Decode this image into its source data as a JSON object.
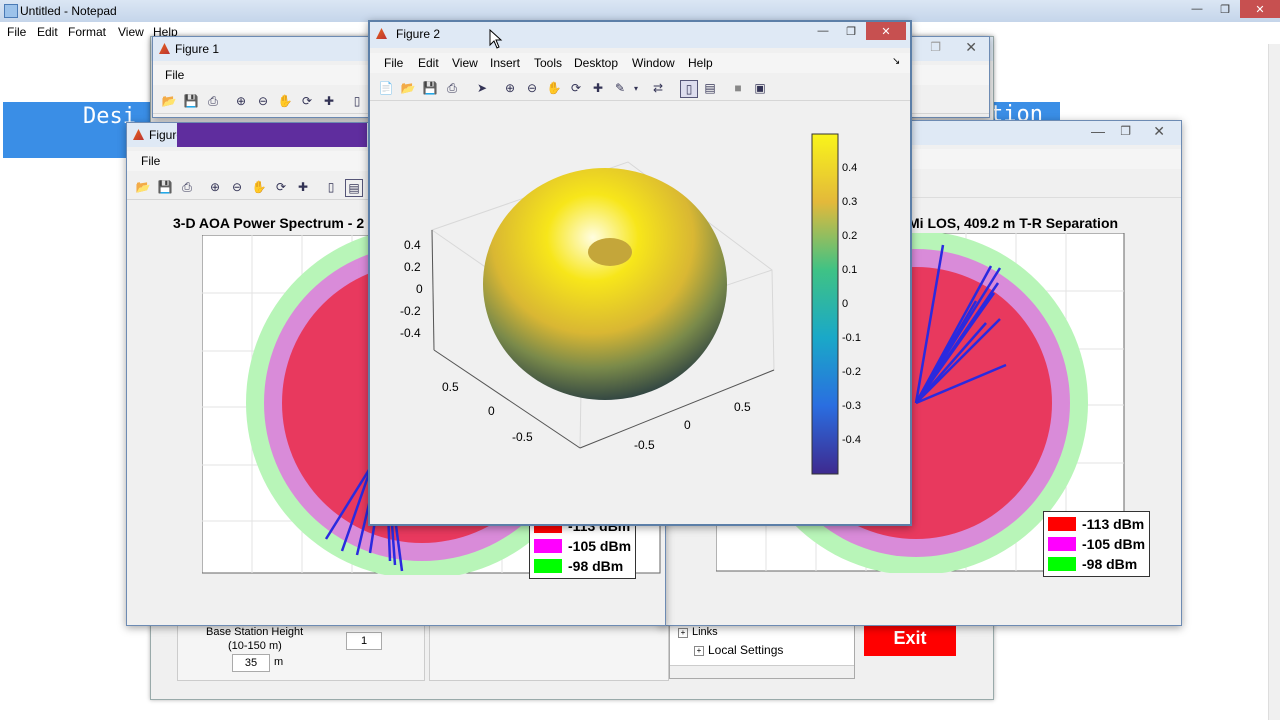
{
  "notepad": {
    "title": "Untitled - Notepad",
    "menu": [
      "File",
      "Edit",
      "Format",
      "View",
      "Help"
    ]
  },
  "app": {
    "banner_left": "Desi",
    "banner_right": "tion",
    "bs_height_label_1": "Base Station Height",
    "bs_height_label_2": "(10-150 m)",
    "bs_height_value": "35",
    "bs_height_unit": "m",
    "count_value": "1",
    "tree_items": [
      "Links",
      "Local Settings"
    ],
    "exit_label": "Exit"
  },
  "figure1": {
    "title": "Figure 1",
    "menu": [
      "File"
    ]
  },
  "figure3": {
    "title": "Figure 3",
    "menu": [
      "File"
    ],
    "plot_title": "3-D AOA Power Spectrum - 2",
    "legend": [
      {
        "label": "-113 dBm",
        "color": "#ff0000"
      },
      {
        "label": "-105 dBm",
        "color": "#ff00ff"
      },
      {
        "label": "-98 dBm",
        "color": "#00ff00"
      }
    ]
  },
  "figure_right": {
    "plot_title": "Hz, UMi LOS, 409.2 m T-R Separation",
    "legend": [
      {
        "label": "-113 dBm",
        "color": "#ff0000"
      },
      {
        "label": "-105 dBm",
        "color": "#ff00ff"
      },
      {
        "label": "-98 dBm",
        "color": "#00ff00"
      }
    ]
  },
  "figure2": {
    "title": "Figure 2",
    "menu": [
      "File",
      "Edit",
      "View",
      "Insert",
      "Tools",
      "Desktop",
      "Window",
      "Help"
    ],
    "z_ticks": [
      "0.4",
      "0.2",
      "0",
      "-0.2",
      "-0.4"
    ],
    "x_ticks": [
      "0.5",
      "0",
      "-0.5"
    ],
    "y_ticks": [
      "0.5",
      "0",
      "-0.5"
    ],
    "colorbar_ticks": [
      "0.4",
      "0.3",
      "0.2",
      "0.1",
      "0",
      "-0.1",
      "-0.2",
      "-0.3",
      "-0.4"
    ]
  },
  "colors": {
    "title_bar": "#dfe9f5",
    "banner": "#3a8ee6",
    "exit": "#ff0000",
    "ring_inner": "#e8395e",
    "ring_mid": "#d98bd9",
    "ring_outer": "#b8f5b8",
    "rays": "#2a2adf"
  }
}
